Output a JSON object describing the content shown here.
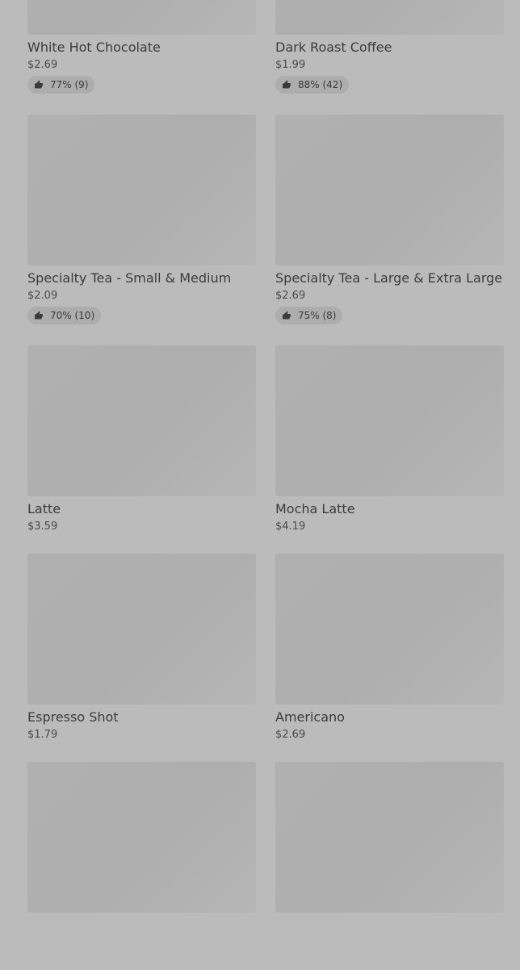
{
  "rows": [
    [
      {
        "name": "White Hot Chocolate",
        "price": "$2.69",
        "rating": "77% (9)"
      },
      {
        "name": "Dark Roast Coffee",
        "price": "$1.99",
        "rating": "88% (42)"
      }
    ],
    [
      {
        "name": "Specialty Tea - Small & Medium",
        "price": "$2.09",
        "rating": "70% (10)"
      },
      {
        "name": "Specialty Tea - Large & Extra Large",
        "price": "$2.69",
        "rating": "75% (8)"
      }
    ],
    [
      {
        "name": "Latte",
        "price": "$3.59"
      },
      {
        "name": "Mocha Latte",
        "price": "$4.19"
      }
    ],
    [
      {
        "name": "Espresso Shot",
        "price": "$1.79"
      },
      {
        "name": "Americano",
        "price": "$2.69"
      }
    ],
    [
      {
        "name": "",
        "price": ""
      },
      {
        "name": "",
        "price": ""
      }
    ]
  ],
  "icons": {
    "rating": "thumbs-up-icon"
  }
}
